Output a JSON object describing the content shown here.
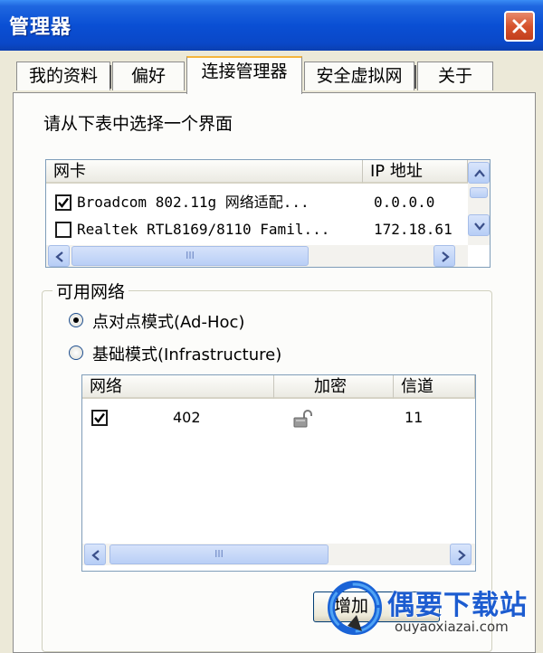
{
  "window": {
    "title": "管理器"
  },
  "tabs": [
    {
      "label": "我的资料"
    },
    {
      "label": "偏好"
    },
    {
      "label": "连接管理器",
      "active": true
    },
    {
      "label": "安全虚拟网"
    },
    {
      "label": "关于"
    }
  ],
  "instruction": "请从下表中选择一个界面",
  "adapters": {
    "headers": [
      "网卡",
      "IP 地址"
    ],
    "rows": [
      {
        "checked": true,
        "name": "Broadcom 802.11g 网络适配...",
        "ip": "0.0.0.0"
      },
      {
        "checked": false,
        "name": "Realtek RTL8169/8110 Famil...",
        "ip": "172.18.61"
      }
    ],
    "hscroll_grip": "III"
  },
  "networks_group": {
    "label": "可用网络",
    "options": [
      {
        "label": "点对点模式(Ad-Hoc)",
        "selected": true
      },
      {
        "label": "基础模式(Infrastructure)",
        "selected": false
      }
    ],
    "headers": [
      "网络",
      "加密",
      "信道"
    ],
    "rows": [
      {
        "checked": true,
        "network": "402",
        "encryption_icon": "unlocked-padlock-icon",
        "channel": "11"
      }
    ],
    "hscroll_grip": "III",
    "button_label": "增加"
  },
  "watermark": {
    "title": "偶要下载站",
    "url": "ouyaoxiazai.com"
  },
  "colors": {
    "titlebar": "#0a4fd4",
    "active_tab_accent": "#f5b53c",
    "close": "#d6532e"
  }
}
